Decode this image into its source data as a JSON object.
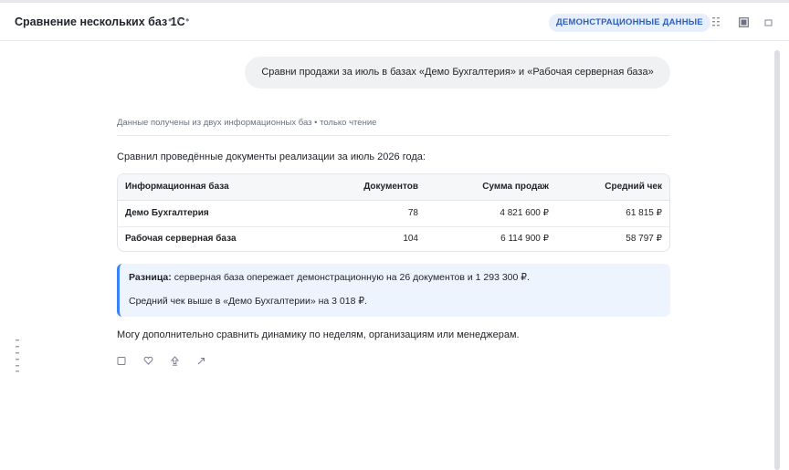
{
  "header": {
    "title": "Сравнение нескольких баз 1С",
    "more_icon": "more-horizontal-icon",
    "badge": "ДЕМОНСТРАЦИОННЫЕ ДАННЫЕ",
    "icons": [
      "grid-icon",
      "sidebar-icon",
      "maximize-icon"
    ]
  },
  "user_message": "Сравни продажи за июль в базах «Демо Бухгалтерия» и «Рабочая серверная база»",
  "response": {
    "meta": "Данные получены из двух информационных баз • только чтение",
    "intro": "Сравнил проведённые документы реализации за июль 2026 года:",
    "table": {
      "headers": [
        "Информационная база",
        "Документов",
        "Сумма продаж",
        "Средний чек"
      ],
      "rows": [
        [
          "Демо Бухгалтерия",
          "78",
          "4 821 600 ₽",
          "61 815 ₽"
        ],
        [
          "Рабочая серверная база",
          "104",
          "6 114 900 ₽",
          "58 797 ₽"
        ]
      ]
    },
    "callout": {
      "label": "Разница:",
      "line1": " серверная база опережает демонстрационную на 26 документов и 1 293 300 ₽.",
      "line2": "Средний чек выше в «Демо Бухгалтерии» на 3 018 ₽."
    },
    "outro": "Могу дополнительно сравнить динамику по неделям, организациям или менеджерам.",
    "action_icons": [
      "copy-icon",
      "heart-icon",
      "thumbs-down-icon",
      "share-icon"
    ]
  },
  "colors": {
    "accent": "#3b82f6",
    "badge_bg": "#e7effd",
    "badge_text": "#2a5fc2",
    "callout_bg": "#eef4fd"
  }
}
